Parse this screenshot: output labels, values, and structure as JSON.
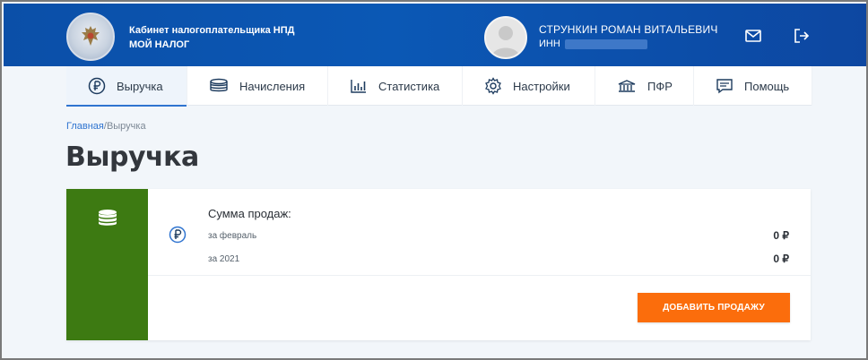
{
  "header": {
    "brand_line1": "Кабинет налогоплательщика НПД",
    "brand_line2": "МОЙ НАЛОГ",
    "user_name": "СТРУНКИН РОМАН ВИТАЛЬЕВИЧ",
    "inn_label": "ИНН",
    "icons": [
      "logo-emblem",
      "user-avatar",
      "mail-icon",
      "logout-icon"
    ]
  },
  "nav": {
    "items": [
      {
        "label": "Выручка",
        "icon": "ruble-icon",
        "active": true
      },
      {
        "label": "Начисления",
        "icon": "coins-stack-icon",
        "active": false
      },
      {
        "label": "Статистика",
        "icon": "bar-chart-icon",
        "active": false
      },
      {
        "label": "Настройки",
        "icon": "gear-icon",
        "active": false
      },
      {
        "label": "ПФР",
        "icon": "pfr-building-icon",
        "active": false
      },
      {
        "label": "Помощь",
        "icon": "chat-help-icon",
        "active": false
      }
    ]
  },
  "breadcrumb": {
    "home": "Главная",
    "separator": "/",
    "current": "Выручка"
  },
  "page": {
    "title": "Выручка"
  },
  "sales_card": {
    "title": "Сумма продаж:",
    "rows": [
      {
        "label": "за февраль",
        "value": "0 ₽"
      },
      {
        "label": "за 2021",
        "value": "0 ₽"
      }
    ],
    "add_button_label": "ДОБАВИТЬ ПРОДАЖУ"
  },
  "colors": {
    "header_blue": "#0b4fa8",
    "accent_blue": "#2f74d0",
    "card_green": "#3d7a12",
    "button_orange": "#fb6d0c"
  }
}
